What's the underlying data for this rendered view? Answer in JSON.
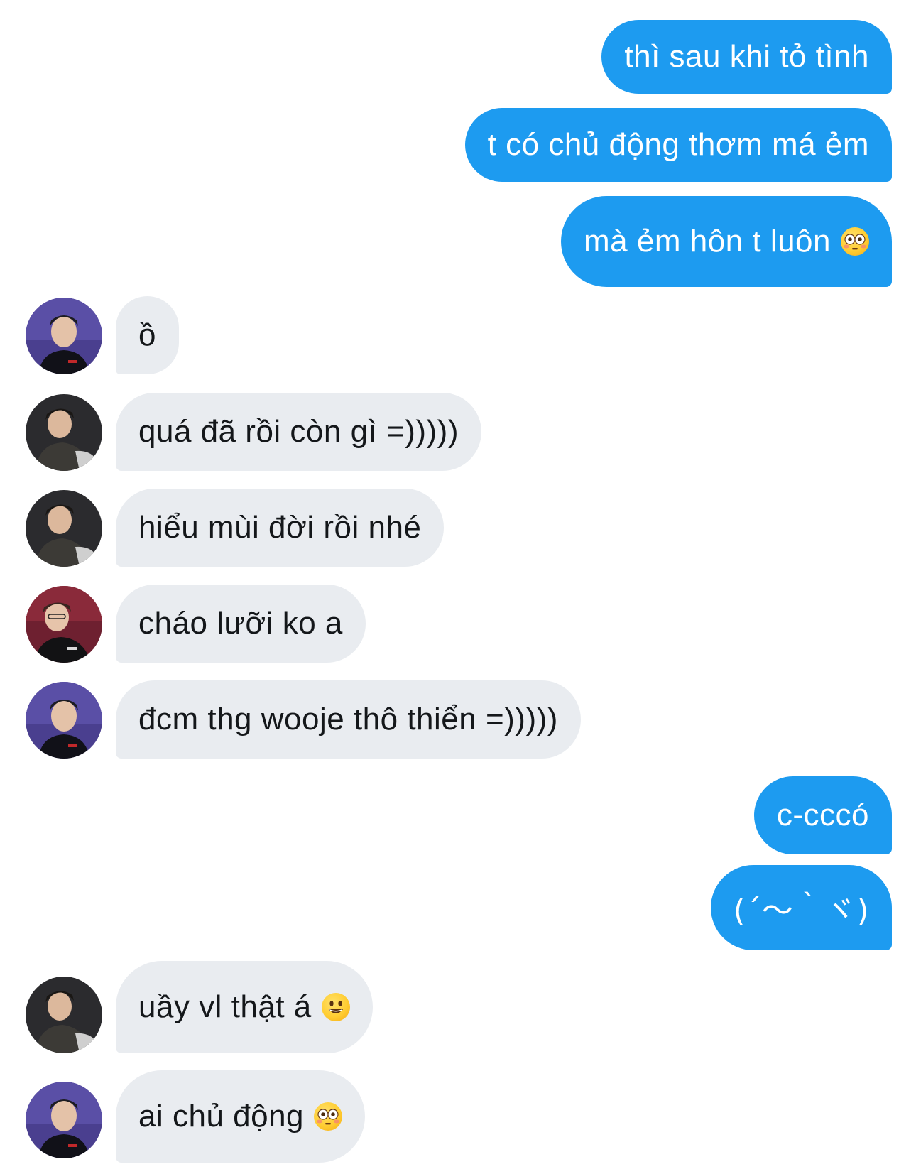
{
  "messages": [
    {
      "side": "out",
      "text": "thì sau khi tỏ tình"
    },
    {
      "side": "out",
      "text": "t có chủ động thơm má ẻm"
    },
    {
      "side": "out",
      "text": "mà ẻm hôn t luôn",
      "emoji": "flushed-face-icon"
    },
    {
      "side": "in",
      "text": "ồ",
      "avatar": "purple-avatar"
    },
    {
      "side": "in",
      "text": "quá đã rồi còn gì =)))))",
      "avatar": "dark-avatar"
    },
    {
      "side": "in",
      "text": "hiểu mùi đời rồi nhé",
      "avatar": "dark-avatar"
    },
    {
      "side": "in",
      "text": "cháo lưỡi ko a",
      "avatar": "red-avatar"
    },
    {
      "side": "in",
      "text": "đcm thg wooje thô thiển =)))))",
      "avatar": "purple-avatar"
    },
    {
      "side": "out",
      "text": "c-cccó"
    },
    {
      "side": "out",
      "text": "(´〜｀ヾ)"
    },
    {
      "side": "in",
      "text": "uầy vl thật á",
      "emoji": "smiley-face-icon",
      "avatar": "dark-avatar"
    },
    {
      "side": "in",
      "text": "ai chủ động",
      "emoji": "flushed-face-icon",
      "avatar": "purple-avatar"
    }
  ],
  "colors": {
    "outgoing_bubble": "#1d9bf0",
    "incoming_bubble": "#e9ecf0",
    "incoming_text": "#14171a",
    "outgoing_text": "#ffffff"
  }
}
